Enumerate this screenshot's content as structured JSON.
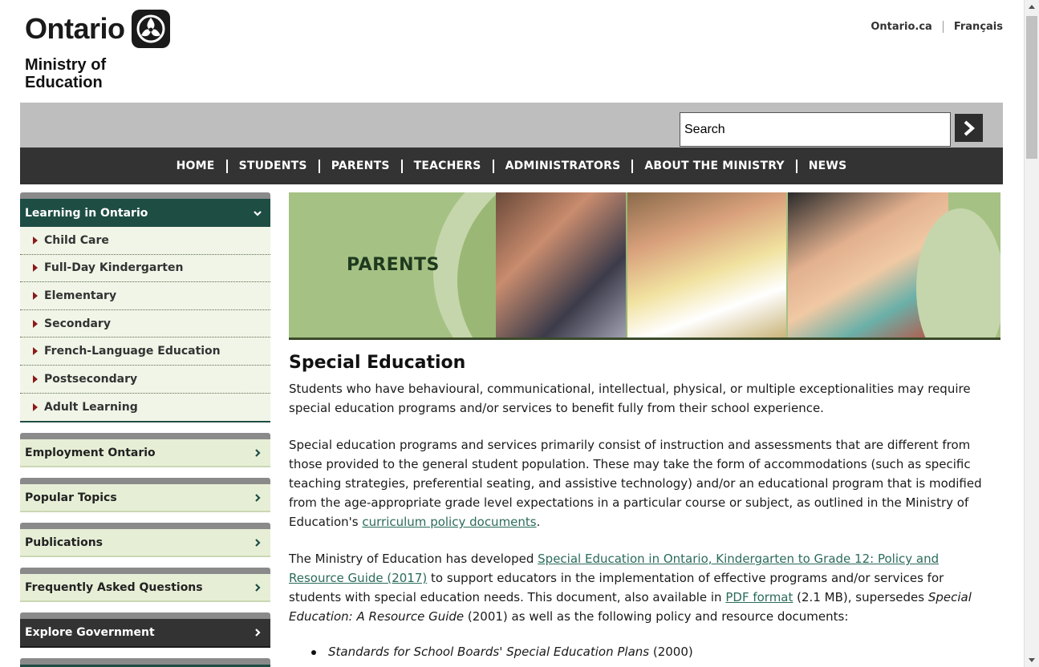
{
  "header": {
    "logo_text": "Ontario",
    "ministry_line1": "Ministry of",
    "ministry_line2": "Education",
    "top_links": [
      "Ontario.ca",
      "Français"
    ]
  },
  "search": {
    "placeholder": "Search",
    "value": "Search"
  },
  "nav": [
    "HOME",
    "STUDENTS",
    "PARENTS",
    "TEACHERS",
    "ADMINISTRATORS",
    "ABOUT THE MINISTRY",
    "NEWS"
  ],
  "sidebar": {
    "open_section": {
      "title": "Learning in Ontario",
      "items": [
        "Child Care",
        "Full-Day Kindergarten",
        "Elementary",
        "Secondary",
        "French-Language Education",
        "Postsecondary",
        "Adult Learning"
      ]
    },
    "sections": [
      "Employment Ontario",
      "Popular Topics",
      "Publications",
      "Frequently Asked Questions"
    ],
    "dark_section": "Explore Government"
  },
  "banner": {
    "label": "PARENTS"
  },
  "content": {
    "title": "Special Education",
    "p1": "Students who have behavioural, communicational, intellectual, physical, or multiple exceptionalities may require special education programs and/or services to benefit fully from their school experience.",
    "p2_text": "Special education programs and services primarily consist of instruction and assessments that are different from those provided to the general student population. These may take the form of accommodations (such as specific teaching strategies, preferential seating, and assistive technology) and/or an educational program that is modified from the age-appropriate grade level expectations in a particular course or subject, as outlined in the Ministry of Education's ",
    "p2_link": "curriculum policy documents",
    "p2_end": ".",
    "p3_a": "The Ministry of Education has developed ",
    "p3_link1": "Special Education in Ontario, Kindergarten to Grade 12: Policy and Resource Guide (2017)",
    "p3_b": " to support educators in the implementation of effective programs and/or services for students with special education needs. This document, also available in ",
    "p3_link2": "PDF format",
    "p3_c": " (2.1 MB), supersedes ",
    "p3_italic": "Special Education: A Resource Guide",
    "p3_d": " (2001) as well as the following policy and resource documents:",
    "list_item1_italic": "Standards for School Boards' Special Education Plans",
    "list_item1_year": " (2000)"
  },
  "colors": {
    "nav_bg": "#333333",
    "sidebar_open_head": "#1e4d44",
    "sidebar_head": "#e6efd6",
    "link": "#2b6b5a",
    "banner_green": "#a6c184"
  }
}
